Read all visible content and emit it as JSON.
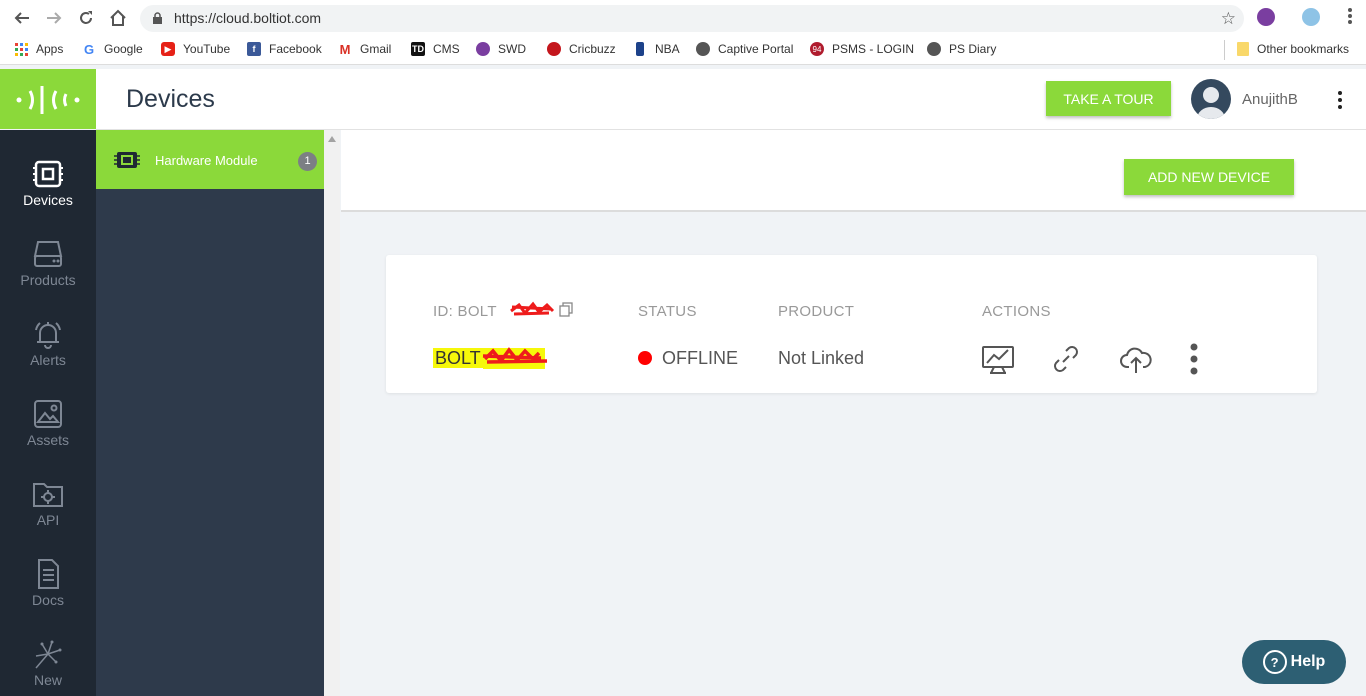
{
  "browser": {
    "url": "https://cloud.boltiot.com",
    "bookmarks": [
      {
        "label": "Apps",
        "icon": "apps-grid-icon",
        "color": "#4285f4"
      },
      {
        "label": "Google",
        "icon": "google-icon",
        "color": "#4285f4"
      },
      {
        "label": "YouTube",
        "icon": "youtube-icon",
        "color": "#e62117"
      },
      {
        "label": "Facebook",
        "icon": "facebook-icon",
        "color": "#3b5998"
      },
      {
        "label": "Gmail",
        "icon": "gmail-icon",
        "color": "#d93025"
      },
      {
        "label": "CMS",
        "icon": "td-icon",
        "color": "#111111"
      },
      {
        "label": "SWD",
        "icon": "swd-icon",
        "color": "#7a3ea0"
      },
      {
        "label": "Cricbuzz",
        "icon": "cricbuzz-icon",
        "color": "#c4161c"
      },
      {
        "label": "NBA",
        "icon": "nba-icon",
        "color": "#1d428a"
      },
      {
        "label": "Captive Portal",
        "icon": "globe-icon",
        "color": "#555555"
      },
      {
        "label": "PSMS - LOGIN",
        "icon": "psms-icon",
        "color": "#b01c2e"
      },
      {
        "label": "PS Diary",
        "icon": "globe-icon",
        "color": "#555555"
      }
    ],
    "other_bookmarks": "Other bookmarks"
  },
  "app": {
    "page_title": "Devices",
    "take_tour_label": "TAKE A TOUR",
    "username": "AnujithB",
    "nav": [
      {
        "label": "Devices",
        "icon": "chip-icon",
        "active": true
      },
      {
        "label": "Products",
        "icon": "drive-icon",
        "active": false
      },
      {
        "label": "Alerts",
        "icon": "bell-icon",
        "active": false
      },
      {
        "label": "Assets",
        "icon": "image-icon",
        "active": false
      },
      {
        "label": "API",
        "icon": "folder-gear-icon",
        "active": false
      },
      {
        "label": "Docs",
        "icon": "document-icon",
        "active": false
      },
      {
        "label": "New",
        "icon": "sparkle-icon",
        "active": false
      }
    ],
    "module": {
      "label": "Hardware Module",
      "count": "1"
    },
    "add_device_label": "ADD NEW DEVICE",
    "device": {
      "headers": {
        "id": "ID: BOLT",
        "status": "STATUS",
        "product": "PRODUCT",
        "actions": "ACTIONS"
      },
      "id_value": "BOLT",
      "status": "OFFLINE",
      "status_color": "#ff0000",
      "product": "Not Linked",
      "actions": [
        "chart-icon",
        "link-icon",
        "cloud-upload-icon",
        "more-vertical-icon"
      ]
    },
    "help_label": "Help",
    "accent_color": "#8bd93a"
  }
}
